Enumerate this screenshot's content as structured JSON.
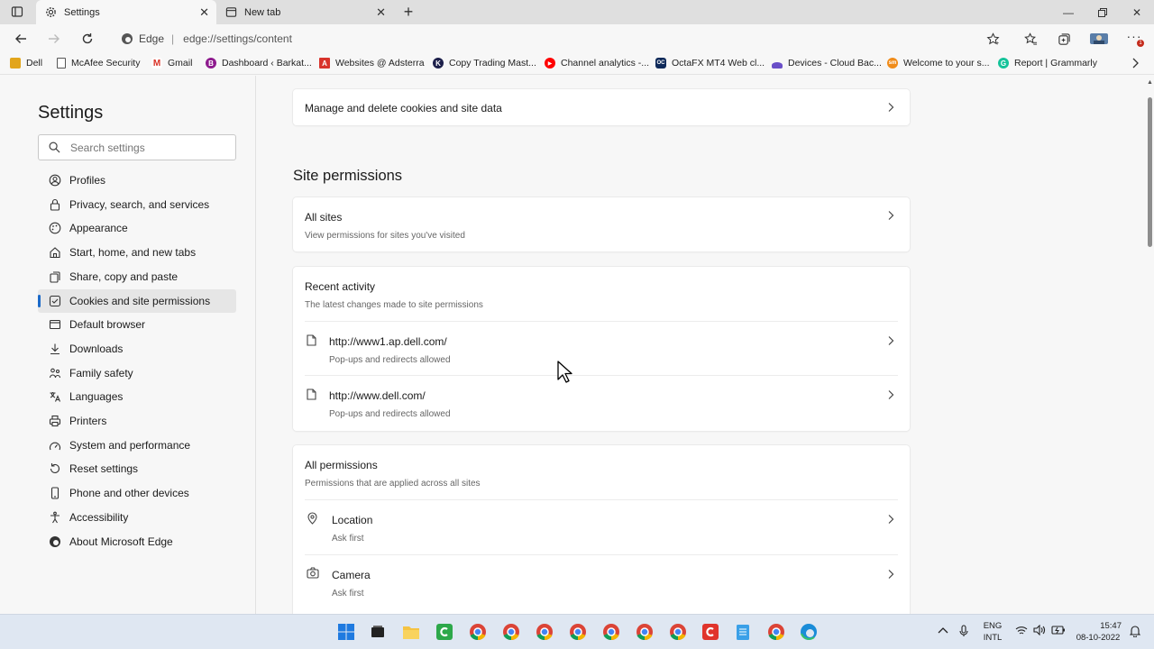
{
  "tabs": [
    {
      "label": "Settings",
      "icon": "gear-icon",
      "active": true
    },
    {
      "label": "New tab",
      "icon": "newtab-icon",
      "active": false
    }
  ],
  "address": {
    "brand": "Edge",
    "url": "edge://settings/content"
  },
  "favorites": [
    {
      "label": "Dell",
      "icon": "folder-icon",
      "color": "#e2a51b"
    },
    {
      "label": "McAfee Security",
      "icon": "page-icon",
      "color": "#555555"
    },
    {
      "label": "Gmail",
      "icon": "gmail-icon",
      "color": "#d93025"
    },
    {
      "label": "Dashboard ‹ Barkat...",
      "icon": "dashboard-icon",
      "color": "#8e1b8e"
    },
    {
      "label": "Websites @ Adsterra",
      "icon": "adsterra-icon",
      "color": "#d8332b"
    },
    {
      "label": "Copy Trading Mast...",
      "icon": "copytrading-icon",
      "color": "#1c1f4a"
    },
    {
      "label": "Channel analytics -...",
      "icon": "youtube-icon",
      "color": "#ff0000"
    },
    {
      "label": "OctaFX MT4 Web cl...",
      "icon": "octafx-icon",
      "color": "#0f2a5a"
    },
    {
      "label": "Devices - Cloud Bac...",
      "icon": "cloud-icon",
      "color": "#6a4fc8"
    },
    {
      "label": "Welcome to your s...",
      "icon": "welcome-icon",
      "color": "#f08c1a"
    },
    {
      "label": "Report | Grammarly",
      "icon": "grammarly-icon",
      "color": "#15c39a"
    }
  ],
  "sidebar": {
    "title": "Settings",
    "search_placeholder": "Search settings",
    "items": [
      {
        "label": "Profiles",
        "icon": "profile-icon"
      },
      {
        "label": "Privacy, search, and services",
        "icon": "lock-icon"
      },
      {
        "label": "Appearance",
        "icon": "appearance-icon"
      },
      {
        "label": "Start, home, and new tabs",
        "icon": "home-icon"
      },
      {
        "label": "Share, copy and paste",
        "icon": "share-icon"
      },
      {
        "label": "Cookies and site permissions",
        "icon": "cookies-icon",
        "active": true
      },
      {
        "label": "Default browser",
        "icon": "browser-icon"
      },
      {
        "label": "Downloads",
        "icon": "download-icon"
      },
      {
        "label": "Family safety",
        "icon": "family-icon"
      },
      {
        "label": "Languages",
        "icon": "languages-icon"
      },
      {
        "label": "Printers",
        "icon": "printer-icon"
      },
      {
        "label": "System and performance",
        "icon": "system-icon"
      },
      {
        "label": "Reset settings",
        "icon": "reset-icon"
      },
      {
        "label": "Phone and other devices",
        "icon": "phone-icon"
      },
      {
        "label": "Accessibility",
        "icon": "accessibility-icon"
      },
      {
        "label": "About Microsoft Edge",
        "icon": "edge-icon"
      }
    ]
  },
  "main": {
    "manage_cookies": "Manage and delete cookies and site data",
    "section_title": "Site permissions",
    "all_sites": {
      "title": "All sites",
      "subtitle": "View permissions for sites you've visited"
    },
    "recent": {
      "title": "Recent activity",
      "subtitle": "The latest changes made to site permissions",
      "items": [
        {
          "url": "http://www1.ap.dell.com/",
          "status": "Pop-ups and redirects allowed"
        },
        {
          "url": "http://www.dell.com/",
          "status": "Pop-ups and redirects allowed"
        }
      ]
    },
    "all_permissions": {
      "title": "All permissions",
      "subtitle": "Permissions that are applied across all sites",
      "items": [
        {
          "label": "Location",
          "status": "Ask first",
          "icon": "location-icon"
        },
        {
          "label": "Camera",
          "status": "Ask first",
          "icon": "camera-icon"
        }
      ]
    }
  },
  "taskbar": {
    "lang_line1": "ENG",
    "lang_line2": "INTL",
    "time": "15:47",
    "date": "08-10-2022"
  }
}
